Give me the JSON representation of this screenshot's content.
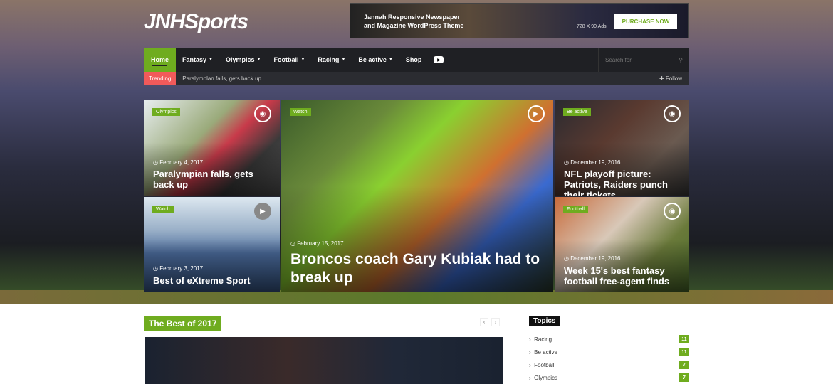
{
  "logo": "JNHSports",
  "ad": {
    "text": "Jannah Responsive Newspaper and Magazine WordPress Theme",
    "size": "728 X 90 Ads",
    "button": "PURCHASE NOW"
  },
  "nav": {
    "items": [
      "Home",
      "Fantasy",
      "Olympics",
      "Football",
      "Racing",
      "Be active",
      "Shop"
    ],
    "search_placeholder": "Search for"
  },
  "trending": {
    "label": "Trending",
    "text": "Paralymplan falls, gets back up",
    "follow": "Follow"
  },
  "tiles": [
    {
      "badge": "Olympics",
      "date": "February 4, 2017",
      "title": "Paralympian falls, gets back up",
      "icon": "camera-icon"
    },
    {
      "badge": "Watch",
      "date": "February 3, 2017",
      "title": "Best of eXtreme Sport",
      "icon": "play-icon"
    },
    {
      "badge": "Watch",
      "date": "February 15, 2017",
      "title": "Broncos coach Gary Kubiak had to break up",
      "icon": "play-icon"
    },
    {
      "badge": "Be active",
      "date": "December 19, 2016",
      "title": "NFL playoff picture: Patriots, Raiders punch their tickets",
      "icon": "camera-icon"
    },
    {
      "badge": "Football",
      "date": "December 19, 2016",
      "title": "Week 15's best fantasy football free-agent finds",
      "icon": "camera-icon"
    }
  ],
  "section": {
    "title": "The Best of 2017"
  },
  "topics": {
    "title": "Topics",
    "items": [
      {
        "name": "Racing",
        "count": "11"
      },
      {
        "name": "Be active",
        "count": "11"
      },
      {
        "name": "Football",
        "count": "7"
      },
      {
        "name": "Olympics",
        "count": "7"
      }
    ]
  },
  "colors": {
    "accent": "#6fac1f",
    "trending": "#f25a5a",
    "nav": "#1f2024"
  }
}
